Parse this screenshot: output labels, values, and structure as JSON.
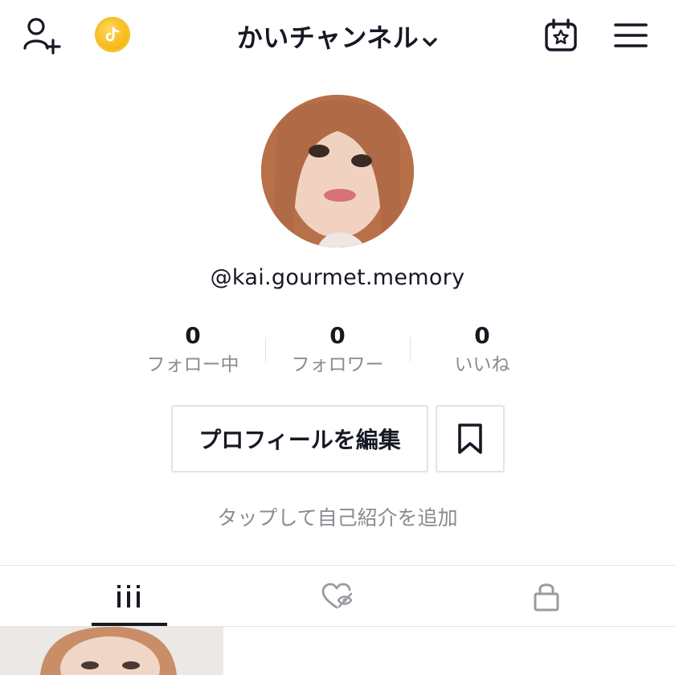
{
  "header": {
    "title": "かいチャンネル",
    "add_user_icon": "add-user-icon",
    "coin_icon": "coin-icon",
    "calendar_icon": "calendar-star-icon",
    "menu_icon": "hamburger-menu-icon"
  },
  "profile": {
    "handle": "@kai.gourmet.memory",
    "stats": [
      {
        "value": "0",
        "label": "フォロー中"
      },
      {
        "value": "0",
        "label": "フォロワー"
      },
      {
        "value": "0",
        "label": "いいね"
      }
    ],
    "edit_button_label": "プロフィールを編集",
    "bio_placeholder": "タップして自己紹介を追加"
  },
  "tabs": [
    {
      "name": "videos",
      "icon": "grid-icon",
      "selected": true
    },
    {
      "name": "liked",
      "icon": "hidden-heart-icon",
      "selected": false
    },
    {
      "name": "private",
      "icon": "lock-icon",
      "selected": false
    }
  ],
  "colors": {
    "text": "#161823",
    "secondary_text": "#8a8b91",
    "border": "#e3e3e4",
    "coin": "#f7b91a"
  }
}
